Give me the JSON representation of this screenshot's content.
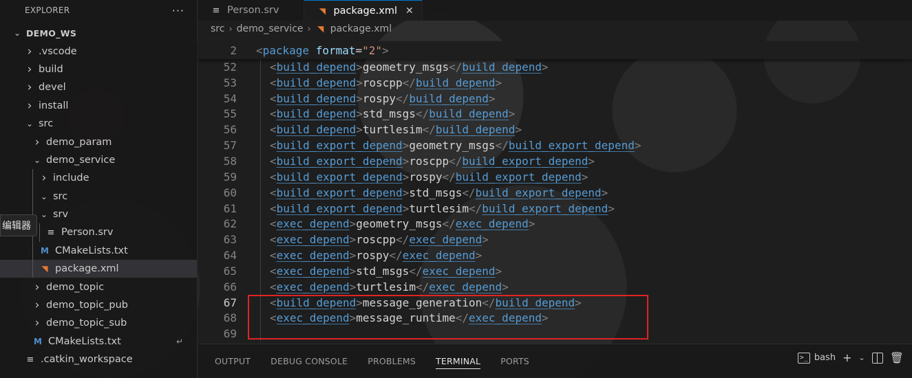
{
  "explorer": {
    "title": "EXPLORER",
    "more": "···",
    "root": "DEMO_WS",
    "items": [
      {
        "label": ".vscode",
        "kind": "folder",
        "state": "closed",
        "depth": 1
      },
      {
        "label": "build",
        "kind": "folder",
        "state": "closed",
        "depth": 1
      },
      {
        "label": "devel",
        "kind": "folder",
        "state": "closed",
        "depth": 1
      },
      {
        "label": "install",
        "kind": "folder",
        "state": "closed",
        "depth": 1
      },
      {
        "label": "src",
        "kind": "folder",
        "state": "open",
        "depth": 1
      },
      {
        "label": "demo_param",
        "kind": "folder",
        "state": "closed",
        "depth": 2
      },
      {
        "label": "demo_service",
        "kind": "folder",
        "state": "open",
        "depth": 2
      },
      {
        "label": "include",
        "kind": "folder",
        "state": "closed",
        "depth": 3
      },
      {
        "label": "src",
        "kind": "folder",
        "state": "open",
        "depth": 3
      },
      {
        "label": "srv",
        "kind": "folder",
        "state": "open",
        "depth": 3
      },
      {
        "label": "Person.srv",
        "kind": "srv",
        "depth": 4
      },
      {
        "label": "CMakeLists.txt",
        "kind": "cmake",
        "depth": 3
      },
      {
        "label": "package.xml",
        "kind": "xml",
        "depth": 3,
        "selected": true
      },
      {
        "label": "demo_topic",
        "kind": "folder",
        "state": "closed",
        "depth": 2
      },
      {
        "label": "demo_topic_pub",
        "kind": "folder",
        "state": "closed",
        "depth": 2
      },
      {
        "label": "demo_topic_sub",
        "kind": "folder",
        "state": "closed",
        "depth": 2
      },
      {
        "label": "CMakeLists.txt",
        "kind": "cmake",
        "depth": 2,
        "enter": true
      },
      {
        "label": ".catkin_workspace",
        "kind": "srv",
        "depth": 1
      }
    ],
    "tooltip": "编辑器"
  },
  "tabs": [
    {
      "label": "Person.srv",
      "icon": "list-icon",
      "active": false
    },
    {
      "label": "package.xml",
      "icon": "rss-icon",
      "active": true,
      "close": "✕"
    }
  ],
  "breadcrumb": [
    "src",
    "demo_service",
    "package.xml"
  ],
  "sticky": {
    "num": "2",
    "tag": "package",
    "attr": "format",
    "value": "\"2\""
  },
  "code_lines": [
    {
      "num": "52",
      "tag": "build_depend",
      "text": "geometry_msgs"
    },
    {
      "num": "53",
      "tag": "build_depend",
      "text": "roscpp"
    },
    {
      "num": "54",
      "tag": "build_depend",
      "text": "rospy"
    },
    {
      "num": "55",
      "tag": "build_depend",
      "text": "std_msgs"
    },
    {
      "num": "56",
      "tag": "build_depend",
      "text": "turtlesim"
    },
    {
      "num": "57",
      "tag": "build_export_depend",
      "text": "geometry_msgs"
    },
    {
      "num": "58",
      "tag": "build_export_depend",
      "text": "roscpp"
    },
    {
      "num": "59",
      "tag": "build_export_depend",
      "text": "rospy"
    },
    {
      "num": "60",
      "tag": "build_export_depend",
      "text": "std_msgs"
    },
    {
      "num": "61",
      "tag": "build_export_depend",
      "text": "turtlesim"
    },
    {
      "num": "62",
      "tag": "exec_depend",
      "text": "geometry_msgs"
    },
    {
      "num": "63",
      "tag": "exec_depend",
      "text": "roscpp"
    },
    {
      "num": "64",
      "tag": "exec_depend",
      "text": "rospy"
    },
    {
      "num": "65",
      "tag": "exec_depend",
      "text": "std_msgs"
    },
    {
      "num": "66",
      "tag": "exec_depend",
      "text": "turtlesim"
    },
    {
      "num": "67",
      "tag": "build_depend",
      "text": "message_generation",
      "active": true
    },
    {
      "num": "68",
      "tag": "exec_depend",
      "text": "message_runtime"
    },
    {
      "num": "69",
      "tag": "",
      "text": ""
    }
  ],
  "panel": {
    "tabs": [
      "OUTPUT",
      "DEBUG CONSOLE",
      "PROBLEMS",
      "TERMINAL",
      "PORTS"
    ],
    "active_tab": "TERMINAL",
    "terminal_name": "bash"
  },
  "colors": {
    "highlight_box": "#e02424",
    "tag": "#569cd6",
    "attr": "#9cdcfe",
    "string": "#ce9178",
    "accent": "#0078d4"
  }
}
